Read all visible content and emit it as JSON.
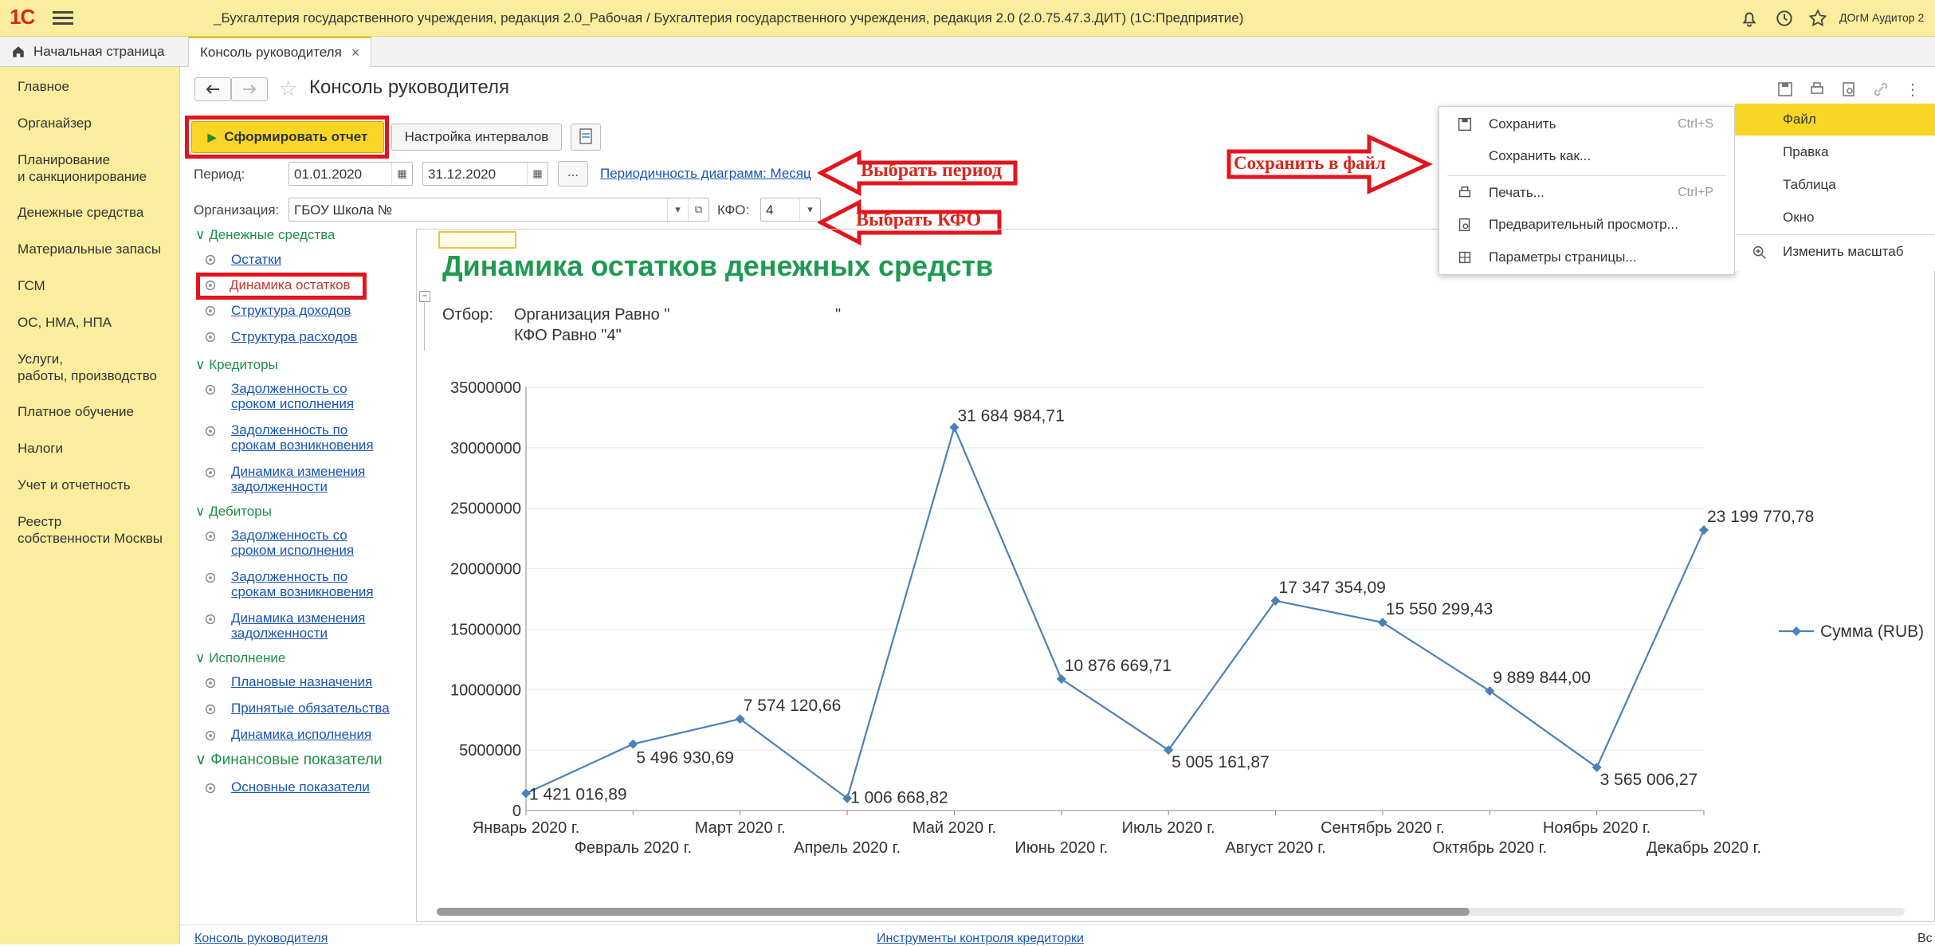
{
  "app": {
    "logo": "1С",
    "title": "_Бухгалтерия государственного учреждения, редакция 2.0_Рабочая / Бухгалтерия государственного учреждения, редакция 2.0 (2.0.75.47.3.ДИТ)  (1С:Предприятие)",
    "user": "ДОгМ Аудитор 2"
  },
  "tabs": {
    "home": "Начальная страница",
    "active": "Консоль руководителя"
  },
  "sidebar": {
    "items": [
      "Главное",
      "Органайзер",
      "Планирование\nи санкционирование",
      "Денежные средства",
      "Материальные запасы",
      "ГСМ",
      "ОС, НМА, НПА",
      "Услуги,\nработы, производство",
      "Платное обучение",
      "Налоги",
      "Учет и отчетность",
      "Реестр\nсобственности Москвы"
    ]
  },
  "toolbar": {
    "page_title": "Консоль руководителя",
    "generate": "Сформировать отчет",
    "intervals": "Настройка интервалов"
  },
  "form": {
    "period_label": "Период:",
    "date_from": "01.01.2020",
    "date_to": "31.12.2020",
    "dots": "...",
    "period_link": "Периодичность диаграмм: Месяц",
    "org_label": "Организация:",
    "org_value": "ГБОУ Школа №",
    "kfo_label": "КФО:",
    "kfo_value": "4"
  },
  "annotations": {
    "period": "Выбрать период",
    "kfo": "Выбрать КФО",
    "save": "Сохранить в файл"
  },
  "tree": {
    "groups": [
      {
        "label": "Денежные средства",
        "items": [
          "Остатки",
          "Динамика остатков",
          "Структура доходов",
          "Структура расходов"
        ]
      },
      {
        "label": "Кредиторы",
        "items": [
          "Задолженность со\nсроком исполнения",
          "Задолженность по\nсрокам возникновения",
          "Динамика изменения\nзадолженности"
        ]
      },
      {
        "label": "Дебиторы",
        "items": [
          "Задолженность со\nсроком исполнения",
          "Задолженность по\nсрокам возникновения",
          "Динамика изменения\nзадолженности"
        ]
      },
      {
        "label": "Исполнение",
        "items": [
          "Плановые назначения",
          "Принятые обязательства",
          "Динамика исполнения"
        ]
      },
      {
        "label": "Финансовые показатели",
        "items": [
          "Основные показатели"
        ]
      }
    ]
  },
  "report": {
    "title": "Динамика остатков денежных средств",
    "filter_label": "Отбор:",
    "filter_line1": "Организация Равно \"",
    "filter_quote": "\"",
    "filter_line2": "КФО Равно \"4\""
  },
  "menu": {
    "items": [
      {
        "label": "Сохранить",
        "shortcut": "Ctrl+S",
        "icon": "save-icon"
      },
      {
        "label": "Сохранить как...",
        "shortcut": "",
        "icon": ""
      },
      {
        "label": "Печать...",
        "shortcut": "Ctrl+P",
        "icon": "print-icon"
      },
      {
        "label": "Предварительный просмотр...",
        "shortcut": "",
        "icon": "preview-icon"
      },
      {
        "label": "Параметры страницы...",
        "shortcut": "",
        "icon": "page-settings-icon"
      }
    ],
    "bar": [
      "Файл",
      "Правка",
      "Таблица",
      "Окно",
      "Изменить масштаб"
    ]
  },
  "footer": {
    "left": "Консоль руководителя",
    "mid": "Инструменты контроля кредиторки",
    "right": "Вс"
  },
  "chart_data": {
    "type": "line",
    "title": "",
    "x": [
      "Январь 2020 г.",
      "Февраль 2020 г.",
      "Март 2020 г.",
      "Апрель 2020 г.",
      "Май 2020 г.",
      "Июнь 2020 г.",
      "Июль 2020 г.",
      "Август 2020 г.",
      "Сентябрь 2020 г.",
      "Октябрь 2020 г.",
      "Ноябрь 2020 г.",
      "Декабрь 2020 г."
    ],
    "series": [
      {
        "name": "Сумма (RUB)",
        "values": [
          1421016.89,
          5496930.69,
          7574120.66,
          1006668.82,
          31684984.71,
          10876669.71,
          5005161.87,
          17347354.09,
          15550299.43,
          9889844.0,
          3565006.27,
          23199770.78
        ],
        "labels": [
          "1 421 016,89",
          "5 496 930,69",
          "7 574 120,66",
          "1 006 668,82",
          "31 684 984,71",
          "10 876 669,71",
          "5 005 161,87",
          "17 347 354,09",
          "15 550 299,43",
          "9 889 844,00",
          "3 565 006,27",
          "23 199 770,78"
        ]
      }
    ],
    "yticks": [
      "0",
      "5000000",
      "10000000",
      "15000000",
      "20000000",
      "25000000",
      "30000000",
      "35000000"
    ],
    "ylim": [
      0,
      35000000
    ],
    "legend": "right",
    "color": "#4a82b8"
  }
}
